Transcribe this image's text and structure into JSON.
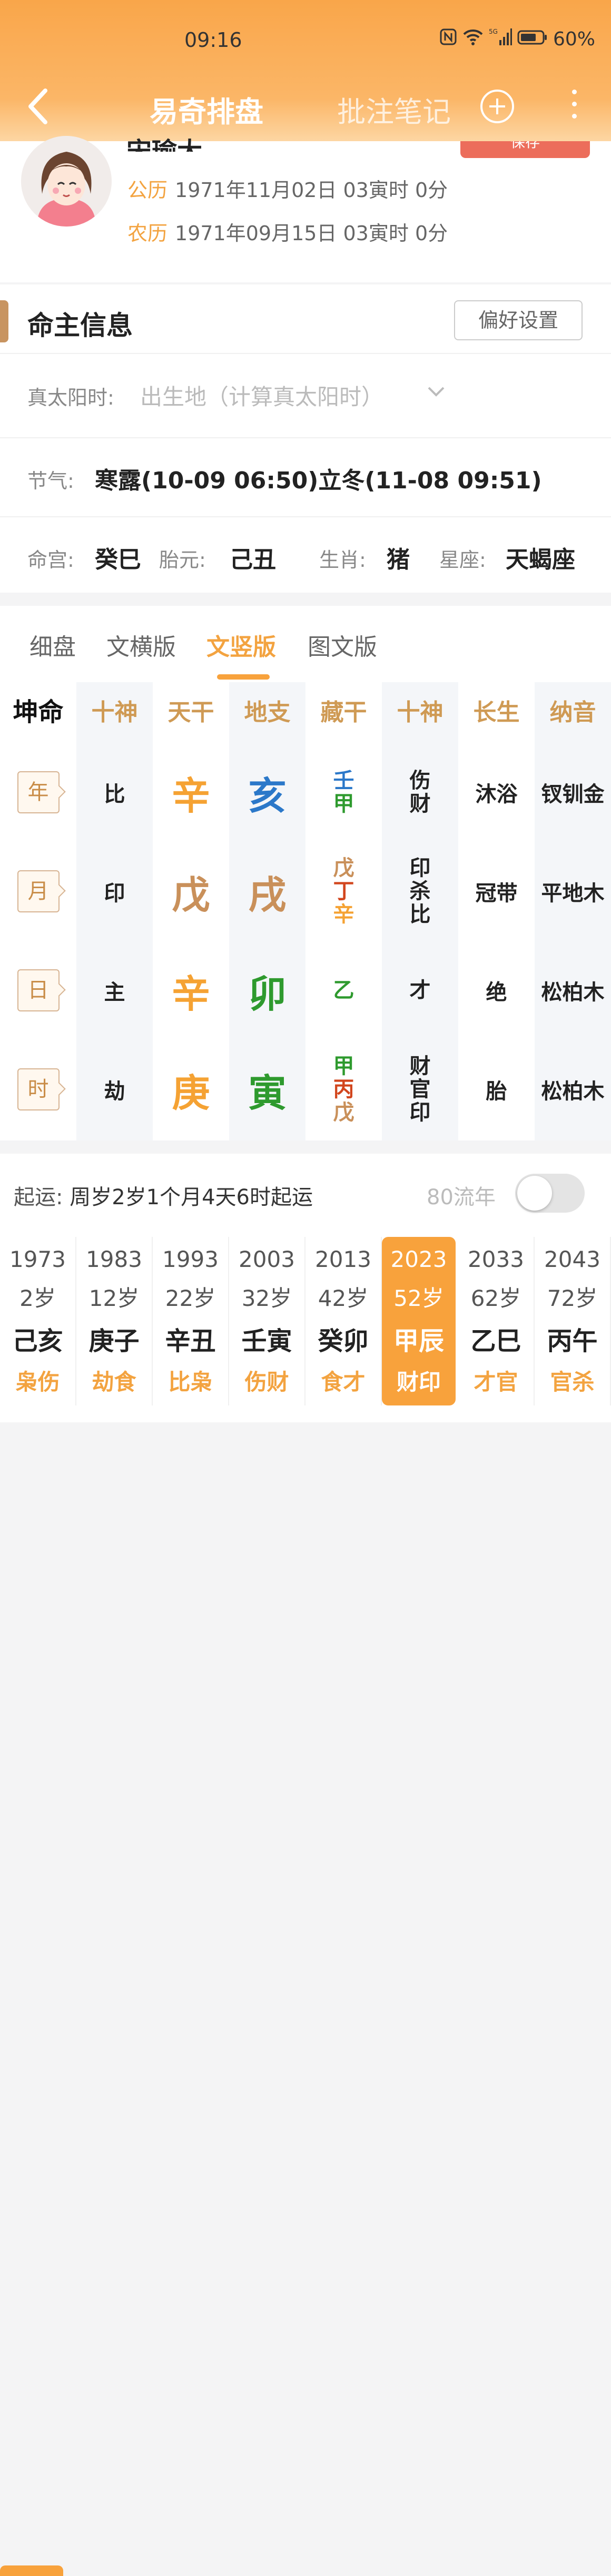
{
  "status": {
    "time": "09:16",
    "network": "5G",
    "battery": "60%"
  },
  "nav": {
    "title": "易奇排盘",
    "notes": "批注笔记"
  },
  "profile": {
    "name": "宋瑜大",
    "save_label": "保存",
    "solar_label": "公历",
    "solar_value": "1971年11月02日 03寅时 0分",
    "lunar_label": "农历",
    "lunar_value": "1971年09月15日 03寅时 0分"
  },
  "info": {
    "title": "命主信息",
    "pref_button": "偏好设置",
    "true_solar_label": "真太阳时:",
    "true_solar_placeholder": "出生地（计算真太阳时）",
    "jieqi_label": "节气:",
    "jieqi_value": "寒露(10-09 06:50)立冬(11-08 09:51)",
    "minggong_label": "命宫:",
    "minggong_value": "癸巳",
    "taiyuan_label": "胎元:",
    "taiyuan_value": "己丑",
    "shengxiao_label": "生肖:",
    "shengxiao_value": "猪",
    "xingzuo_label": "星座:",
    "xingzuo_value": "天蝎座"
  },
  "tabs": [
    "细盘",
    "文横版",
    "文竖版",
    "图文版"
  ],
  "active_tab": "文竖版",
  "chart": {
    "headers": [
      "坤命",
      "十神",
      "天干",
      "地支",
      "藏干",
      "十神",
      "长生",
      "纳音"
    ],
    "rows": [
      {
        "label": "年",
        "shishen": "比",
        "tiangan": "辛",
        "dizhi": "亥",
        "canggan": [
          "壬",
          "甲"
        ],
        "shishen2": [
          "伤",
          "财"
        ],
        "changsheng": "沐浴",
        "nayin": "钗钏金"
      },
      {
        "label": "月",
        "shishen": "印",
        "tiangan": "戊",
        "dizhi": "戌",
        "canggan": [
          "戊",
          "丁",
          "辛"
        ],
        "shishen2": [
          "印",
          "杀",
          "比"
        ],
        "changsheng": "冠带",
        "nayin": "平地木"
      },
      {
        "label": "日",
        "shishen": "主",
        "tiangan": "辛",
        "dizhi": "卯",
        "canggan": [
          "乙"
        ],
        "shishen2": [
          "才"
        ],
        "changsheng": "绝",
        "nayin": "松柏木"
      },
      {
        "label": "时",
        "shishen": "劫",
        "tiangan": "庚",
        "dizhi": "寅",
        "canggan": [
          "甲",
          "丙",
          "戊"
        ],
        "shishen2": [
          "财",
          "官",
          "印"
        ],
        "changsheng": "胎",
        "nayin": "松柏木"
      }
    ],
    "colors": {
      "metal": "#f5a233",
      "earth": "#c9905a",
      "water": "#2b78c9",
      "wood": "#2e9a2e",
      "fire": "#d2461e"
    }
  },
  "yun": {
    "start_label": "起运:",
    "start_value": "周岁2岁1个月4天6时起运",
    "liunian_label": "80流年",
    "dayun": [
      {
        "year": "1973",
        "age": "2岁",
        "ganzhi": "己亥",
        "shishen": "枭伤"
      },
      {
        "year": "1983",
        "age": "12岁",
        "ganzhi": "庚子",
        "shishen": "劫食"
      },
      {
        "year": "1993",
        "age": "22岁",
        "ganzhi": "辛丑",
        "shishen": "比枭"
      },
      {
        "year": "2003",
        "age": "32岁",
        "ganzhi": "壬寅",
        "shishen": "伤财"
      },
      {
        "year": "2013",
        "age": "42岁",
        "ganzhi": "癸卯",
        "shishen": "食才"
      },
      {
        "year": "2023",
        "age": "52岁",
        "ganzhi": "甲辰",
        "shishen": "财印"
      },
      {
        "year": "2033",
        "age": "62岁",
        "ganzhi": "乙巳",
        "shishen": "才官"
      },
      {
        "year": "2043",
        "age": "72岁",
        "ganzhi": "丙午",
        "shishen": "官杀"
      }
    ],
    "active_index": 5
  }
}
